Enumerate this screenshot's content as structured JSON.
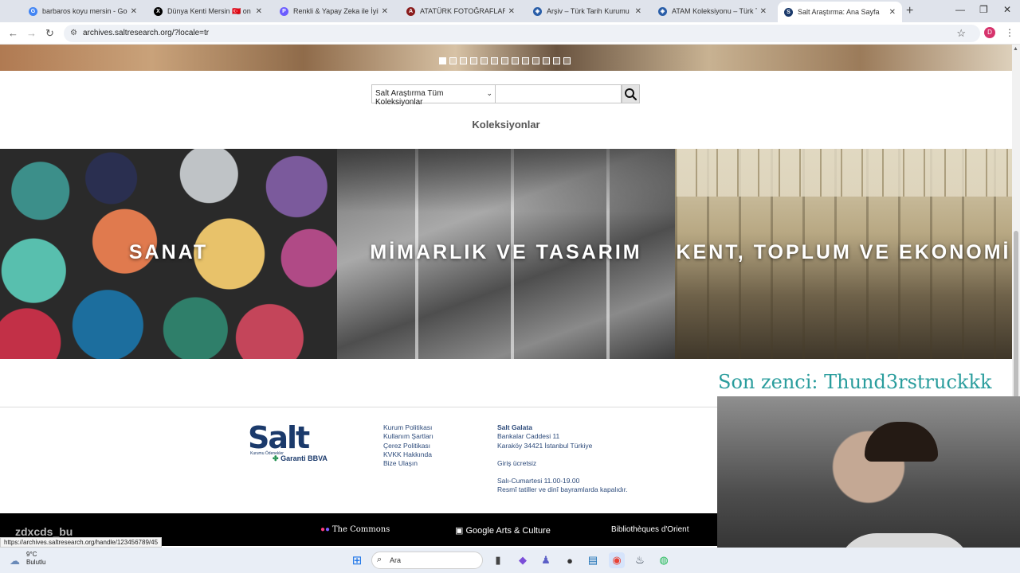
{
  "browser": {
    "tabs": [
      {
        "title": "barbaros koyu mersin - Google",
        "icon": "google-icon",
        "color": "#4285f4",
        "glyph": "G"
      },
      {
        "title": "Dünya Kenti Mersin 🇹🇷 on X: \"M",
        "icon": "x-icon",
        "color": "#000000",
        "glyph": "X"
      },
      {
        "title": "Renkli & Yapay Zeka ile İyileştir",
        "icon": "photo-enhance-icon",
        "color": "#6b5cff",
        "glyph": "P"
      },
      {
        "title": "ATATÜRK FOTOĞRAFLARI - Atat",
        "icon": "archive-icon",
        "color": "#8a1c1c",
        "glyph": "A"
      },
      {
        "title": "Arşiv – Türk Tarih Kurumu",
        "icon": "ttk-icon",
        "color": "#2a5ea8",
        "glyph": "◈"
      },
      {
        "title": "ATAM Koleksiyonu – Türk Tarih",
        "icon": "ttk-icon",
        "color": "#2a5ea8",
        "glyph": "◈"
      },
      {
        "title": "Salt Araştırma: Ana Sayfa",
        "icon": "salt-icon",
        "color": "#1b3a6b",
        "glyph": "S",
        "active": true
      }
    ],
    "url": "archives.saltresearch.org/?locale=tr",
    "profile_initial": "D",
    "status_url": "https://archives.saltresearch.org/handle/123456789/45"
  },
  "page": {
    "carousel_dots": 13,
    "carousel_active": 0,
    "search": {
      "scope_label": "Salt Araştırma Tüm Koleksiyonlar",
      "query": ""
    },
    "collections_title": "Koleksiyonlar",
    "collections": [
      {
        "label": "SANAT"
      },
      {
        "label": "MİMARLIK VE TASARIM"
      },
      {
        "label": "KENT, TOPLUM VE EKONOMİ"
      }
    ]
  },
  "overlay": {
    "stream_text": "Son zenci: Thund3rstruckkk"
  },
  "footer": {
    "logo": "Salt",
    "logo_small": "Kurumu Ödenekler",
    "sponsor_logo": "Garanti BBVA",
    "links": [
      "Kurum Politikası",
      "Kullanım Şartları",
      "Çerez Politikası",
      "KVKK Hakkında",
      "Bize Ulaşın"
    ],
    "venue": "Salt Galata",
    "address_1": "Bankalar Caddesi 11",
    "address_2": "Karaköy 34421 İstanbul Türkiye",
    "entry": "Giriş ücretsiz",
    "hours": "Salı-Cumartesi 11.00-19.00",
    "holidays": "Resmî tatiller ve dinî bayramlarda kapalıdır.",
    "sponsors": [
      "The Commons",
      "Google Arts & Culture",
      "Bibliothèques d'Orient"
    ],
    "left_partial": "zdxcds_bu"
  },
  "taskbar": {
    "weather_temp": "9°C",
    "weather_desc": "Bulutlu",
    "search_placeholder": "Ara"
  }
}
